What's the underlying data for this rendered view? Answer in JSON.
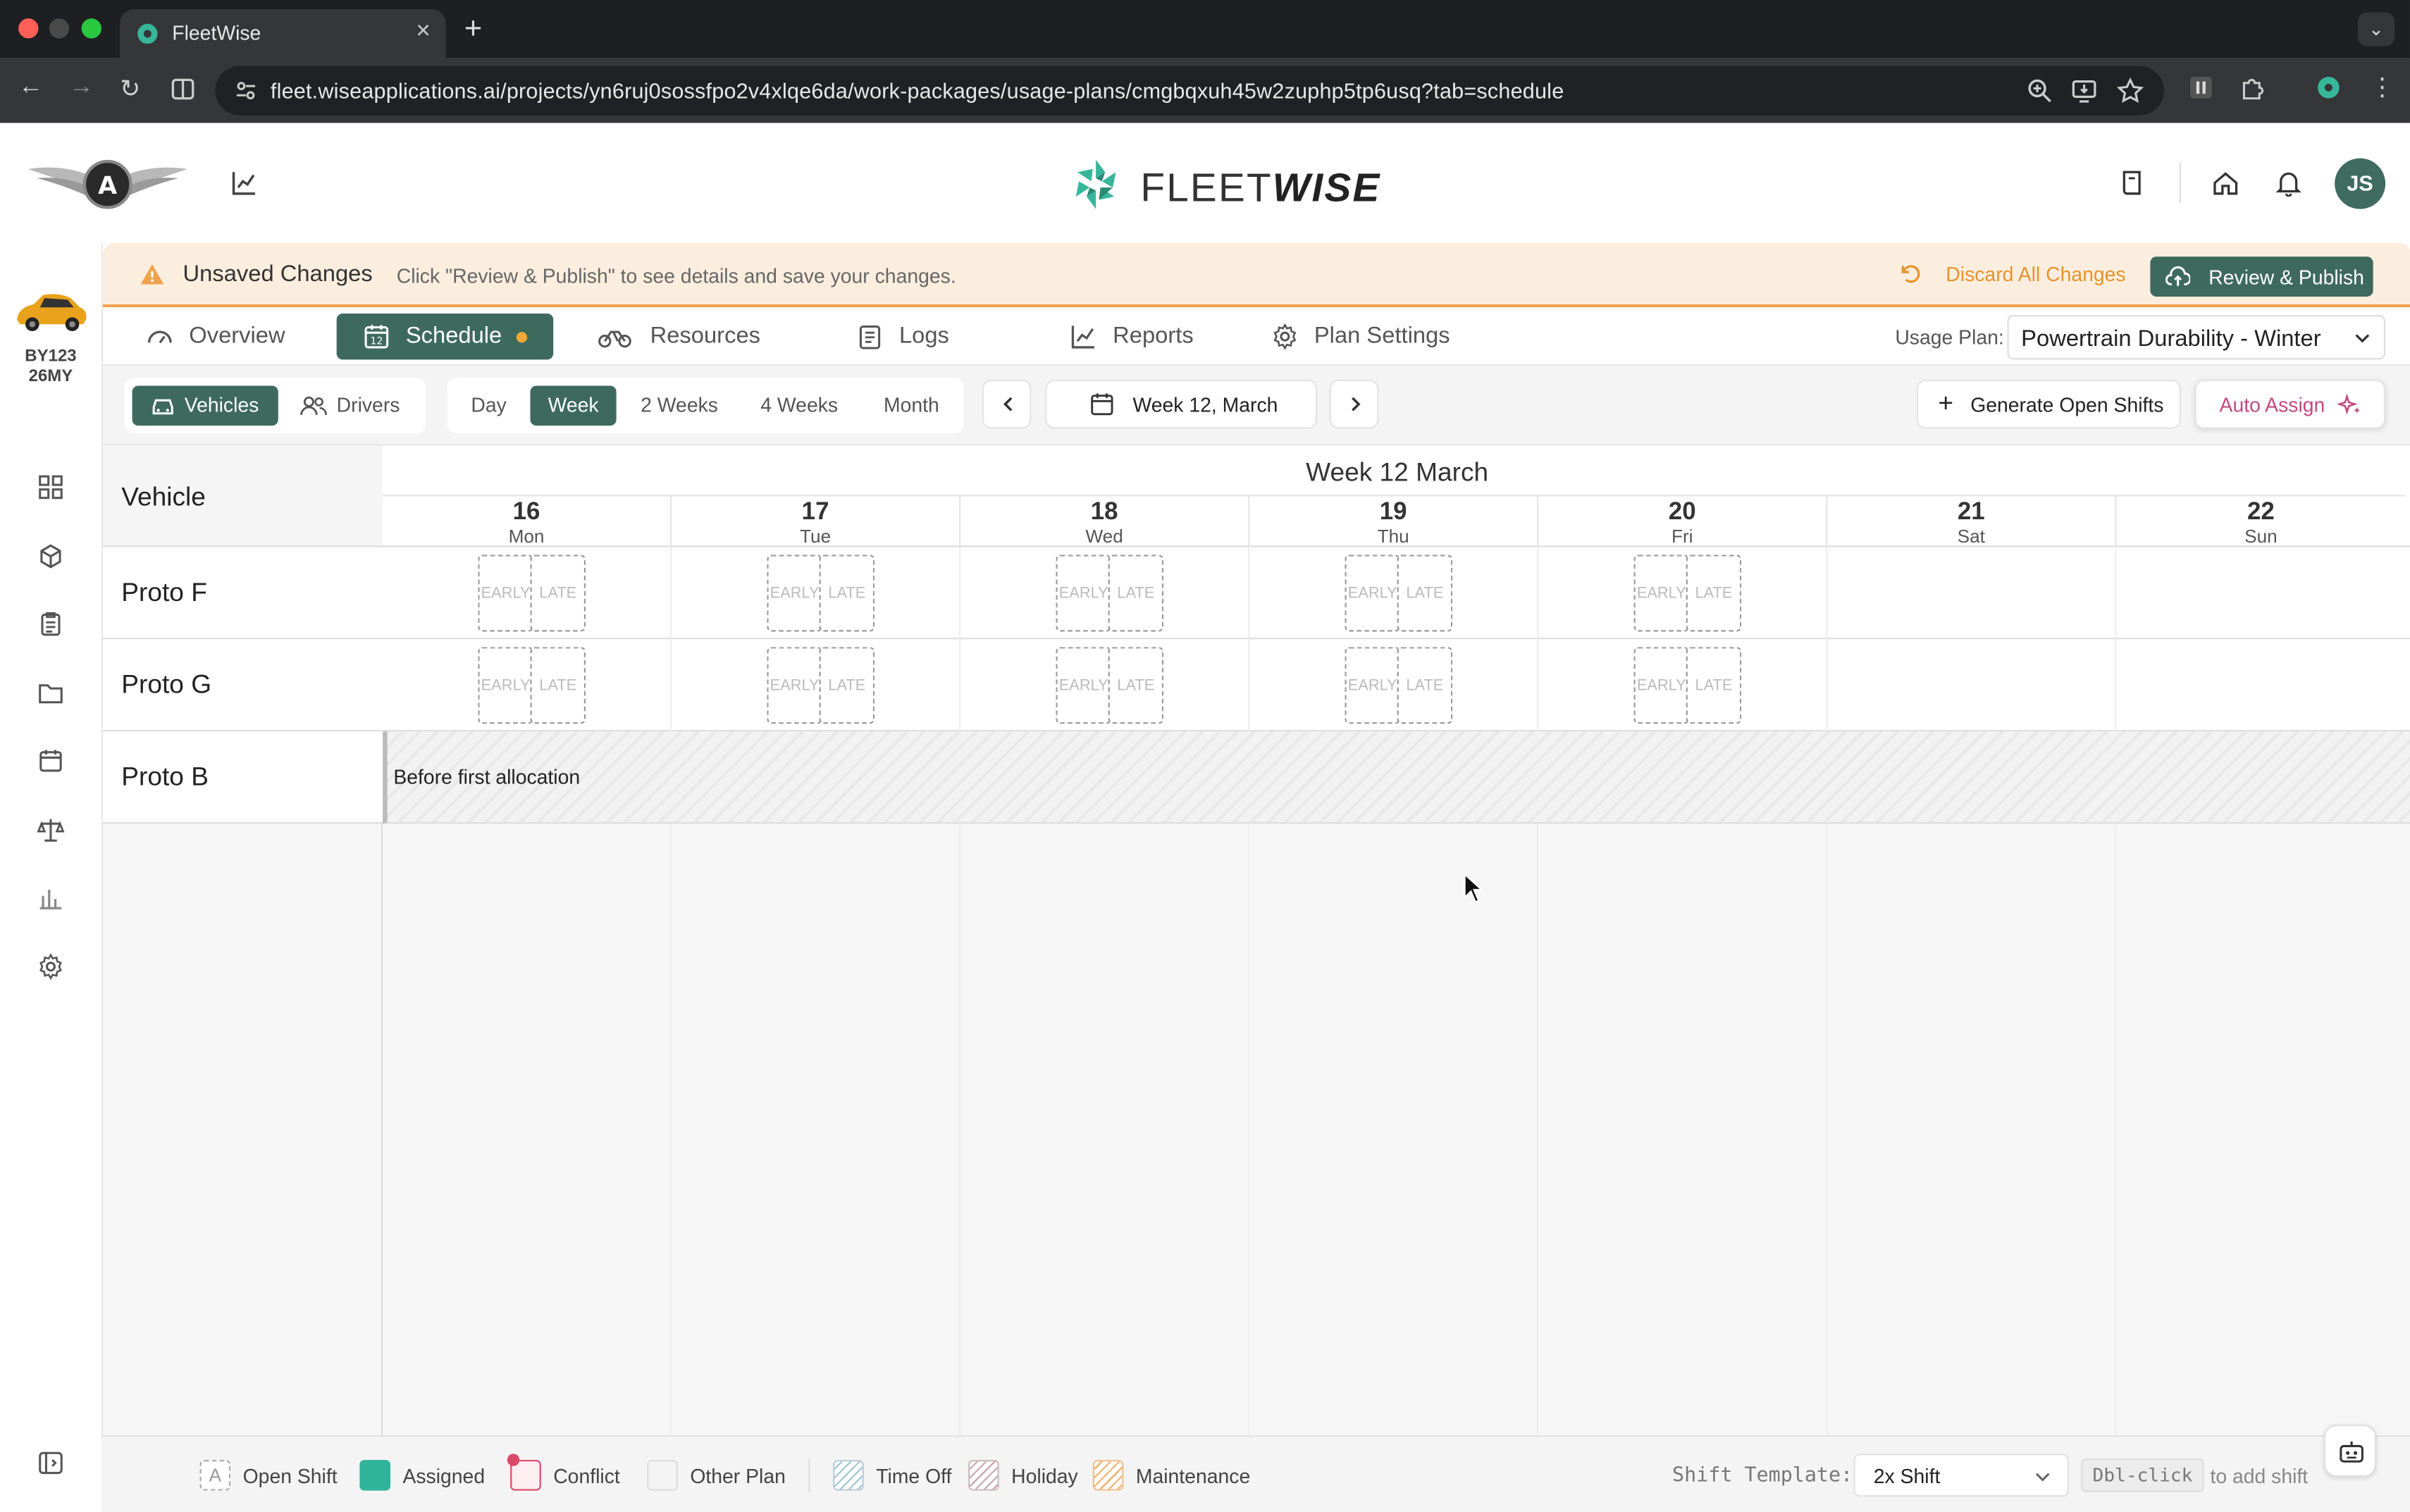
{
  "browser": {
    "tab_title": "FleetWise",
    "url": "fleet.wiseapplications.ai/projects/yn6ruj0sossfpo2v4xlqe6da/work-packages/usage-plans/cmgbqxuh45w2zuphp5tp6usq?tab=schedule"
  },
  "brand": {
    "prefix": "FLEET",
    "suffix": "WISE"
  },
  "user": {
    "initials": "JS"
  },
  "vehicle": {
    "line1": "BY123",
    "line2": "26MY"
  },
  "banner": {
    "title": "Unsaved Changes",
    "desc": "Click \"Review & Publish\" to see details and save your changes.",
    "discard": "Discard All Changes",
    "publish": "Review & Publish"
  },
  "nav": {
    "overview": "Overview",
    "schedule": "Schedule",
    "resources": "Resources",
    "logs": "Logs",
    "reports": "Reports",
    "settings": "Plan Settings",
    "usage_plan_label": "Usage Plan:",
    "usage_plan_value": "Powertrain Durability - Winter"
  },
  "toolbar": {
    "vehicles": "Vehicles",
    "drivers": "Drivers",
    "ranges": [
      "Day",
      "Week",
      "2 Weeks",
      "4 Weeks",
      "Month"
    ],
    "active_range": "Week",
    "current_period": "Week 12, March",
    "generate": "Generate Open Shifts",
    "auto_assign": "Auto Assign"
  },
  "grid": {
    "vehicle_header": "Vehicle",
    "week_title": "Week 12 March",
    "days": [
      {
        "num": "16",
        "name": "Mon"
      },
      {
        "num": "17",
        "name": "Tue"
      },
      {
        "num": "18",
        "name": "Wed"
      },
      {
        "num": "19",
        "name": "Thu"
      },
      {
        "num": "20",
        "name": "Fri"
      },
      {
        "num": "21",
        "name": "Sat"
      },
      {
        "num": "22",
        "name": "Sun"
      }
    ],
    "rows": [
      "Proto F",
      "Proto G",
      "Proto B"
    ],
    "shift_early": "EARLY",
    "shift_late": "LATE",
    "proto_b_note": "Before first allocation"
  },
  "legend": {
    "open_shift": "Open Shift",
    "open_shift_glyph": "A",
    "assigned": "Assigned",
    "conflict": "Conflict",
    "other_plan": "Other Plan",
    "time_off": "Time Off",
    "holiday": "Holiday",
    "maintenance": "Maintenance",
    "shift_template_label": "Shift Template:",
    "shift_template_value": "2x Shift",
    "kbd": "Dbl-click",
    "hint": "to add shift"
  },
  "colors": {
    "accent": "#3e6a5e",
    "warning": "#e8932c",
    "banner_bg": "#fbeedf",
    "assigned": "#2fb39a",
    "conflict": "#d94a6a"
  }
}
